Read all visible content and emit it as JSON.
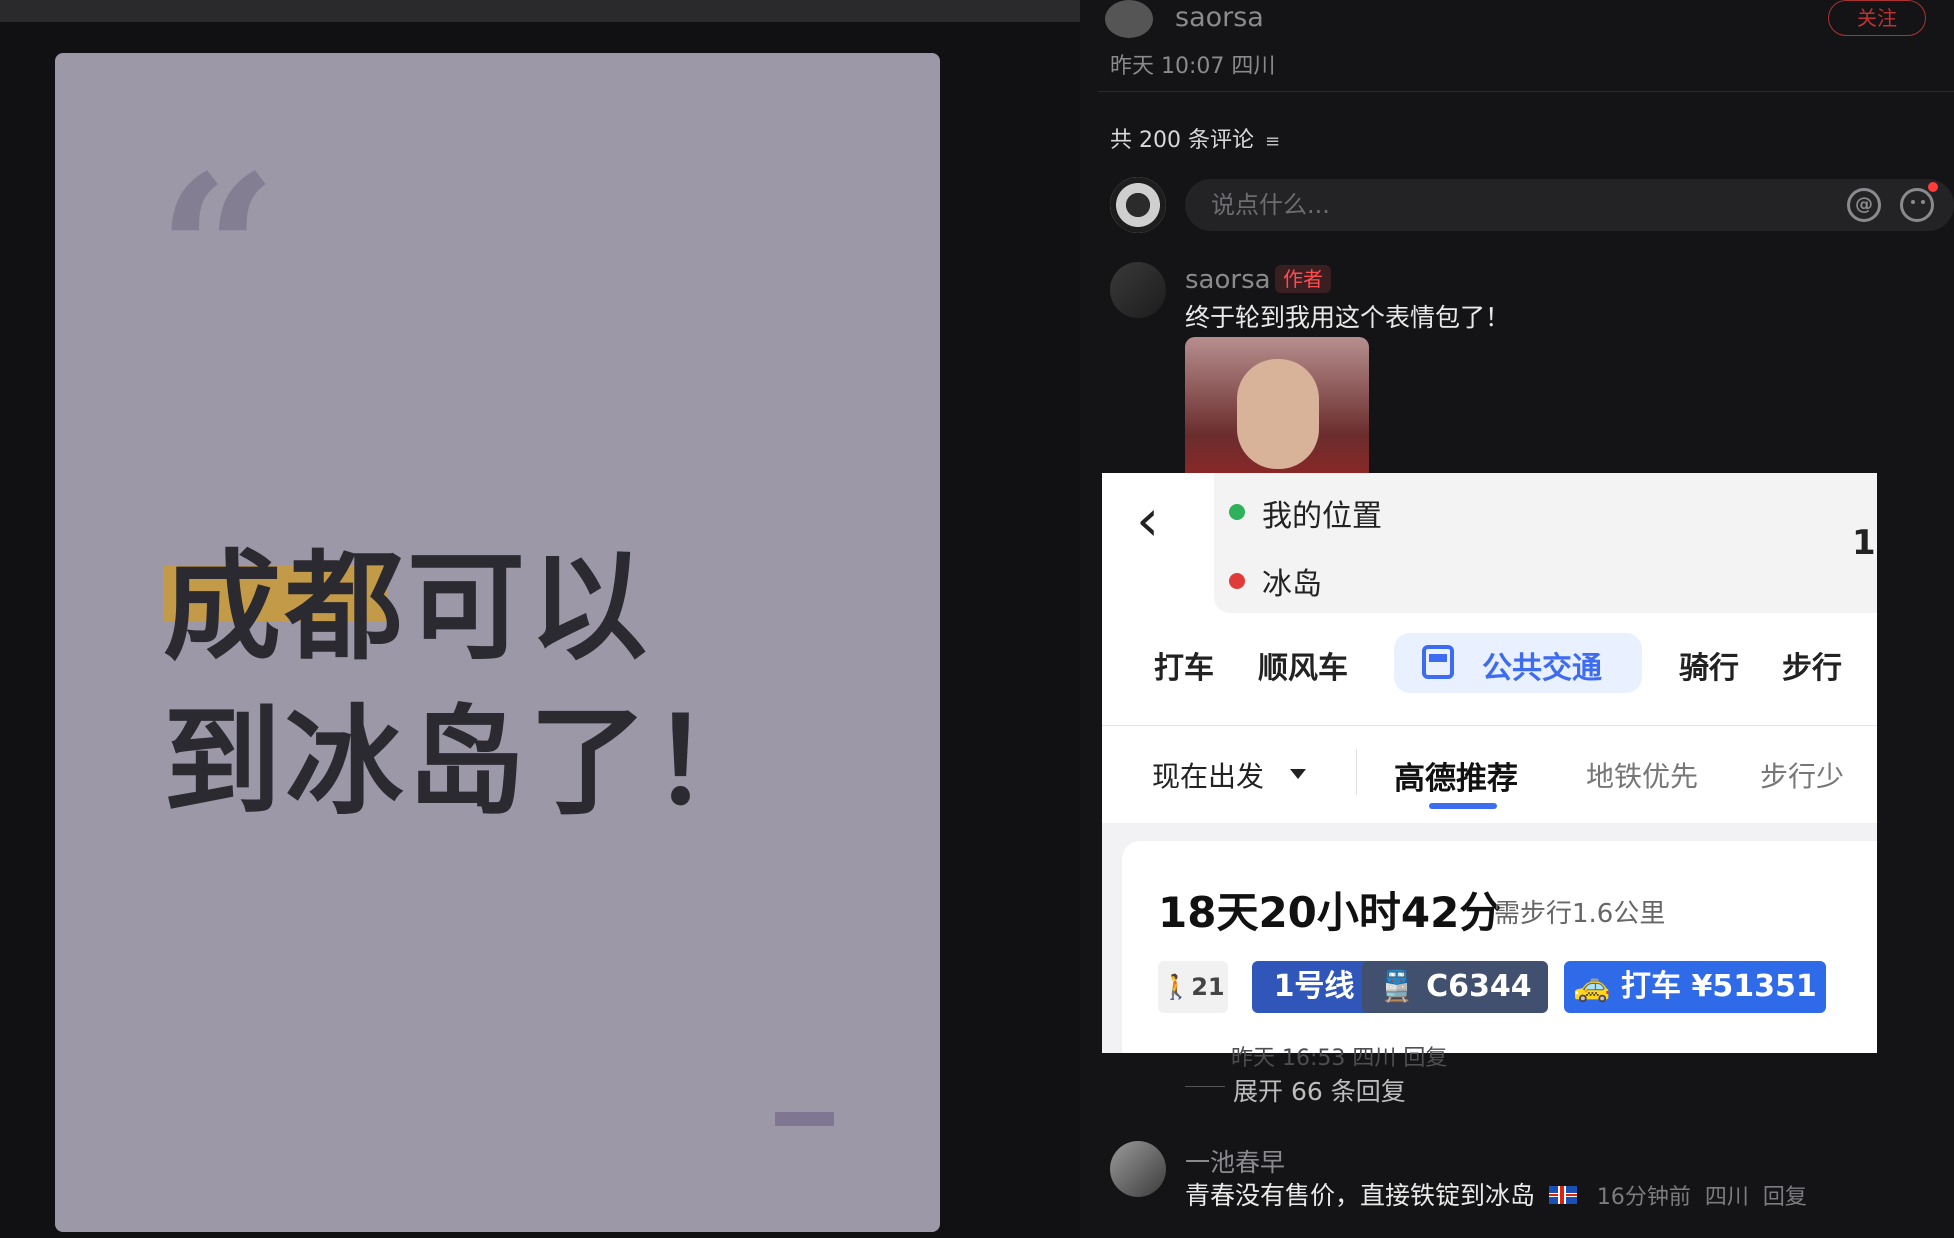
{
  "post": {
    "author_name": "saorsa",
    "follow_label": "关注",
    "meta": "昨天 10:07 四川",
    "card_text_line1": "成都可以",
    "card_text_line2": "到冰岛了！"
  },
  "comments": {
    "count_label": "共 200 条评论",
    "sort_icon": "sort-icon",
    "input_placeholder": "说点什么...",
    "at_icon": "at-icon",
    "emoji_icon": "emoji-icon",
    "items": [
      {
        "name": "saorsa",
        "badge": "作者",
        "text": "终于轮到我用这个表情包了！"
      },
      {
        "name": "一池春早",
        "text": "青春没有售价，直接铁锭到冰岛",
        "flag": "iceland-flag",
        "time": "16分钟前",
        "location": "四川",
        "reply_label": "回复"
      }
    ],
    "faint_meta": "昨天 16:53 四川 回复",
    "expand_replies": "展开 66 条回复"
  },
  "map_overlay": {
    "origin": "我的位置",
    "destination": "冰岛",
    "right_peek": "1",
    "modes": [
      "打车",
      "顺风车",
      "公共交通",
      "骑行",
      "步行"
    ],
    "active_mode": "公共交通",
    "depart_label": "现在出发",
    "filters": [
      "高德推荐",
      "地铁优先",
      "步行少"
    ],
    "active_filter": "高德推荐",
    "route": {
      "duration": "18天20小时42分",
      "walk_note": "需步行1.6公里",
      "chips": {
        "walk": "21",
        "line": "1号线",
        "train": "C6344",
        "taxi": "打车 ¥51351"
      }
    },
    "colors": {
      "accent": "#3e6cf0",
      "green_dot": "#2fb05a",
      "red_dot": "#e03a3a"
    }
  }
}
